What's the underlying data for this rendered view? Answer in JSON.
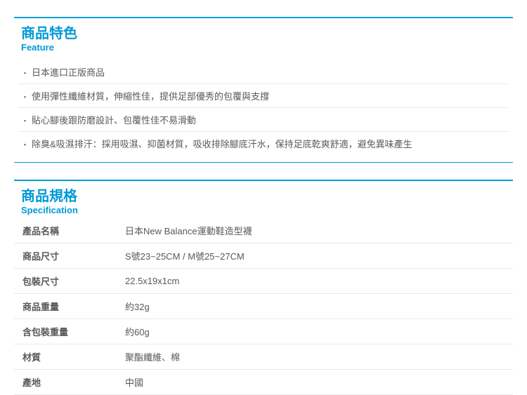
{
  "feature": {
    "title_cn": "商品特色",
    "title_en": "Feature",
    "items": [
      "日本進口正版商品",
      "使用彈性纖維材質，伸縮性佳，提供足部優秀的包覆與支撐",
      "貼心腳後跟防磨設計、包覆性佳不易滑動",
      "除臭&吸濕排汗：採用吸濕、抑菌材質，吸收排除腳底汗水，保持足底乾爽舒適，避免異味產生"
    ]
  },
  "spec": {
    "title_cn": "商品規格",
    "title_en": "Specification",
    "rows": [
      {
        "key": "產品名稱",
        "value": "日本New Balance運動鞋造型襪"
      },
      {
        "key": "商品尺寸",
        "value": "S號23~25CM / M號25~27CM"
      },
      {
        "key": "包裝尺寸",
        "value": "22.5x19x1cm"
      },
      {
        "key": "商品重量",
        "value": "約32g"
      },
      {
        "key": "含包裝重量",
        "value": "約60g"
      },
      {
        "key": "材質",
        "value": "聚酯纖維、棉"
      },
      {
        "key": "產地",
        "value": "中國"
      }
    ]
  }
}
